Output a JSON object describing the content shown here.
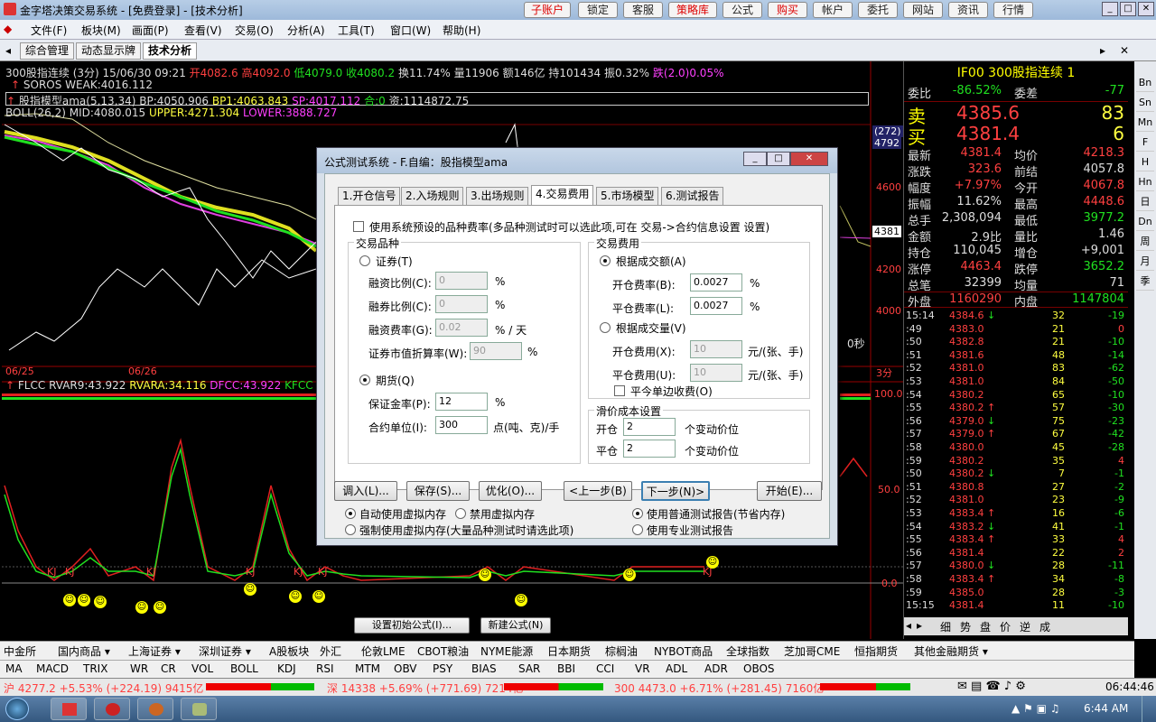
{
  "window": {
    "title": "金字塔决策交易系统 - [免费登录] - [技术分析]",
    "top_buttons": [
      "子账户",
      "锁定",
      "客服",
      "策略库",
      "公式",
      "购买",
      "帐户",
      "委托",
      "网站",
      "资讯",
      "行情"
    ]
  },
  "menu": [
    "文件(F)",
    "板块(M)",
    "画面(P)",
    "查看(V)",
    "交易(O)",
    "分析(A)",
    "工具(T)",
    "窗口(W)",
    "帮助(H)"
  ],
  "tabs": [
    "综合管理",
    "动态显示牌",
    "技术分析"
  ],
  "chart": {
    "header": {
      "name": "300股指连续 (3分) 15/06/30 09:21",
      "open": "开4082.6",
      "high": "高4092.0",
      "low": "低4079.0",
      "close": "收4080.2",
      "turnover": "换11.74%",
      "volume": "量11906",
      "amount": "额146亿",
      "hold": "持101434",
      "amp": "振0.32%",
      "change": "跌(2.0)0.05%"
    },
    "soros": "SOROS WEAK:4016.112",
    "model": {
      "name": "股指模型ama(5,13,34)",
      "bp": "BP:4050.906",
      "bp1": "BP1:4063.843",
      "sp": "SP:4017.112",
      "he": "合:0",
      "zi": "资:1114872.75"
    },
    "boll": {
      "name": "BOLL(26,2)",
      "mid": "MID:4080.015",
      "upper": "UPPER:4271.304",
      "lower": "LOWER:3888.727"
    },
    "price_axis": [
      "4792",
      "4600",
      "4381",
      "4200",
      "4000"
    ],
    "price_box": "(272)",
    "dates": [
      "06/25",
      "06/26"
    ],
    "lower_header": {
      "name": "FLCC",
      "rvar9": "RVAR9:43.922",
      "rvara": "RVARA:34.116",
      "dfcc": "DFCC:43.922",
      "kfcc": "KFCC"
    },
    "lower_axis": [
      "100.0",
      "50.0",
      "0.0"
    ],
    "ticks": "0秒",
    "bar_tag": "3分",
    "signals": [
      "KJ",
      "KJ",
      "KJ",
      "KJ",
      "KJ",
      "KJ",
      "KJ"
    ],
    "btn_setup": "设置初始公式(I)...",
    "btn_new": "新建公式(N)"
  },
  "quote": {
    "title": "IF00  300股指连续  1",
    "weibi": {
      "label": "委比",
      "value": "-86.52%",
      "label2": "委差",
      "value2": "-77"
    },
    "sell": {
      "label": "卖",
      "price": "4385.6",
      "qty": "83"
    },
    "buy": {
      "label": "买",
      "price": "4381.4",
      "qty": "6"
    },
    "rows": [
      {
        "l1": "最新",
        "v1": "4381.4",
        "l2": "均价",
        "v2": "4218.3",
        "c1": "r",
        "c2": "r"
      },
      {
        "l1": "涨跌",
        "v1": "323.6",
        "l2": "前结",
        "v2": "4057.8",
        "c1": "r",
        "c2": "w"
      },
      {
        "l1": "幅度",
        "v1": "+7.97%",
        "l2": "今开",
        "v2": "4067.8",
        "c1": "r",
        "c2": "r"
      },
      {
        "l1": "振幅",
        "v1": "11.62%",
        "l2": "最高",
        "v2": "4448.6",
        "c1": "w",
        "c2": "r"
      },
      {
        "l1": "总手",
        "v1": "2,308,094",
        "l2": "最低",
        "v2": "3977.2",
        "c1": "w",
        "c2": "g"
      },
      {
        "l1": "金额",
        "v1": "2.9比",
        "l2": "量比",
        "v2": "1.46",
        "c1": "w",
        "c2": "w"
      },
      {
        "l1": "持仓",
        "v1": "110,045",
        "l2": "增仓",
        "v2": "+9,001",
        "c1": "w",
        "c2": "w"
      },
      {
        "l1": "涨停",
        "v1": "4463.4",
        "l2": "跌停",
        "v2": "3652.2",
        "c1": "r",
        "c2": "g"
      },
      {
        "l1": "总笔",
        "v1": "32399",
        "l2": "均量",
        "v2": "71",
        "c1": "w",
        "c2": "w"
      }
    ],
    "outer": {
      "label": "外盘",
      "value": "1160290",
      "label2": "内盘",
      "value2": "1147804"
    },
    "trades": [
      {
        "t": "15:14",
        "p": "4384.6",
        "d": "↓",
        "v": "32",
        "c": "-19"
      },
      {
        "t": ":49",
        "p": "4383.0",
        "d": "",
        "v": "21",
        "c": "0"
      },
      {
        "t": ":50",
        "p": "4382.8",
        "d": "",
        "v": "21",
        "c": "-10"
      },
      {
        "t": ":51",
        "p": "4381.6",
        "d": "",
        "v": "48",
        "c": "-14"
      },
      {
        "t": ":52",
        "p": "4381.0",
        "d": "",
        "v": "83",
        "c": "-62"
      },
      {
        "t": ":53",
        "p": "4381.0",
        "d": "",
        "v": "84",
        "c": "-50"
      },
      {
        "t": ":54",
        "p": "4380.2",
        "d": "",
        "v": "65",
        "c": "-10"
      },
      {
        "t": ":55",
        "p": "4380.2",
        "d": "↑",
        "v": "57",
        "c": "-30"
      },
      {
        "t": ":56",
        "p": "4379.0",
        "d": "↓",
        "v": "75",
        "c": "-23"
      },
      {
        "t": ":57",
        "p": "4379.0",
        "d": "↑",
        "v": "67",
        "c": "-42"
      },
      {
        "t": ":58",
        "p": "4380.0",
        "d": "",
        "v": "45",
        "c": "-28"
      },
      {
        "t": ":59",
        "p": "4380.2",
        "d": "",
        "v": "35",
        "c": "4"
      },
      {
        "t": ":50",
        "p": "4380.2",
        "d": "↓",
        "v": "7",
        "c": "-1"
      },
      {
        "t": ":51",
        "p": "4380.8",
        "d": "",
        "v": "27",
        "c": "-2"
      },
      {
        "t": ":52",
        "p": "4381.0",
        "d": "",
        "v": "23",
        "c": "-9"
      },
      {
        "t": ":53",
        "p": "4383.4",
        "d": "↑",
        "v": "16",
        "c": "-6"
      },
      {
        "t": ":54",
        "p": "4383.2",
        "d": "↓",
        "v": "41",
        "c": "-1"
      },
      {
        "t": ":55",
        "p": "4383.4",
        "d": "↑",
        "v": "33",
        "c": "4"
      },
      {
        "t": ":56",
        "p": "4381.4",
        "d": "",
        "v": "22",
        "c": "2"
      },
      {
        "t": ":57",
        "p": "4380.0",
        "d": "↓",
        "v": "28",
        "c": "-11"
      },
      {
        "t": ":58",
        "p": "4383.4",
        "d": "↑",
        "v": "34",
        "c": "-8"
      },
      {
        "t": ":59",
        "p": "4385.0",
        "d": "",
        "v": "28",
        "c": "-3"
      },
      {
        "t": "15:15",
        "p": "4381.4",
        "d": "",
        "v": "11",
        "c": "-10"
      }
    ],
    "bottom_tabs": [
      "细",
      "势",
      "盘",
      "价",
      "逆",
      "成"
    ]
  },
  "side_icons": [
    "Bn",
    "Sn",
    "Mn",
    "F",
    "H",
    "Hn",
    "日",
    "Dn",
    "周",
    "月",
    "季"
  ],
  "markets": [
    "中金所",
    "国内商品 ▾",
    "上海证券 ▾",
    "深圳证券 ▾",
    "A股板块",
    "外汇",
    "伦敦LME",
    "CBOT粮油",
    "NYME能源",
    "日本期货",
    "棕榈油",
    "NYBOT商品",
    "全球指数",
    "芝加哥CME",
    "恒指期货",
    "其他金融期货 ▾"
  ],
  "indicators": [
    "MA",
    "MACD",
    "TRIX",
    "WR",
    "CR",
    "VOL",
    "BOLL",
    "KDJ",
    "RSI",
    "MTM",
    "OBV",
    "PSY",
    "BIAS",
    "SAR",
    "BBI",
    "CCI",
    "VR",
    "ADL",
    "ADR",
    "OBOS"
  ],
  "status": {
    "sh": "沪 4277.2 +5.53% (+224.19) 9415亿",
    "sz": "深 14338 +5.69% (+771.69) 7214亿",
    "i300": "300 4473.0 +6.71% (+281.45) 7160亿",
    "clock": "06:44:46"
  },
  "taskbar": {
    "time": "6:44 AM"
  },
  "dialog": {
    "title": "公式测试系统 - F.自编：股指模型ama",
    "tabs": [
      "1.开仓信号",
      "2.入场规则",
      "3.出场规则",
      "4.交易费用",
      "5.市场模型",
      "6.测试报告"
    ],
    "use_system_fee": "使用系统预设的品种费率(多品种测试时可以选此项,可在 交易->合约信息设置 设置)",
    "variety_group": "交易品种",
    "securities": "证券(T)",
    "margin_ratio": {
      "label": "融资比例(C):",
      "value": "0",
      "unit": "%"
    },
    "short_ratio": {
      "label": "融券比例(C):",
      "value": "0",
      "unit": "%"
    },
    "margin_rate": {
      "label": "融资费率(G):",
      "value": "0.02",
      "unit": "% / 天"
    },
    "market_ratio": {
      "label": "证券市值折算率(W):",
      "value": "90",
      "unit": "%"
    },
    "futures": "期货(Q)",
    "deposit": {
      "label": "保证金率(P):",
      "value": "12",
      "unit": "%"
    },
    "contract_unit": {
      "label": "合约单位(I):",
      "value": "300",
      "unit": "点(吨、克)/手"
    },
    "fee_group": "交易费用",
    "by_amount": "根据成交额(A)",
    "open_rate": {
      "label": "开仓费率(B):",
      "value": "0.0027",
      "unit": "%"
    },
    "close_rate": {
      "label": "平仓费率(L):",
      "value": "0.0027",
      "unit": "%"
    },
    "by_volume": "根据成交量(V)",
    "open_fee": {
      "label": "开仓费用(X):",
      "value": "10",
      "unit": "元/(张、手)"
    },
    "close_fee": {
      "label": "平仓费用(U):",
      "value": "10",
      "unit": "元/(张、手)"
    },
    "close_today": "平今单边收费(O)",
    "slip_group": "滑价成本设置",
    "slip_open": {
      "label": "开仓",
      "value": "2",
      "unit": "个变动价位"
    },
    "slip_close": {
      "label": "平仓",
      "value": "2",
      "unit": "个变动价位"
    },
    "buttons": [
      "调入(L)...",
      "保存(S)...",
      "优化(O)...",
      "<上一步(B)",
      "下一步(N)>",
      "开始(E)..."
    ],
    "opt_auto": "自动使用虚拟内存",
    "opt_disable": "禁用虚拟内存",
    "opt_force": "强制使用虚拟内存(大量品种测试时请选此项)",
    "opt_normal": "使用普通测试报告(节省内存)",
    "opt_pro": "使用专业测试报告"
  }
}
